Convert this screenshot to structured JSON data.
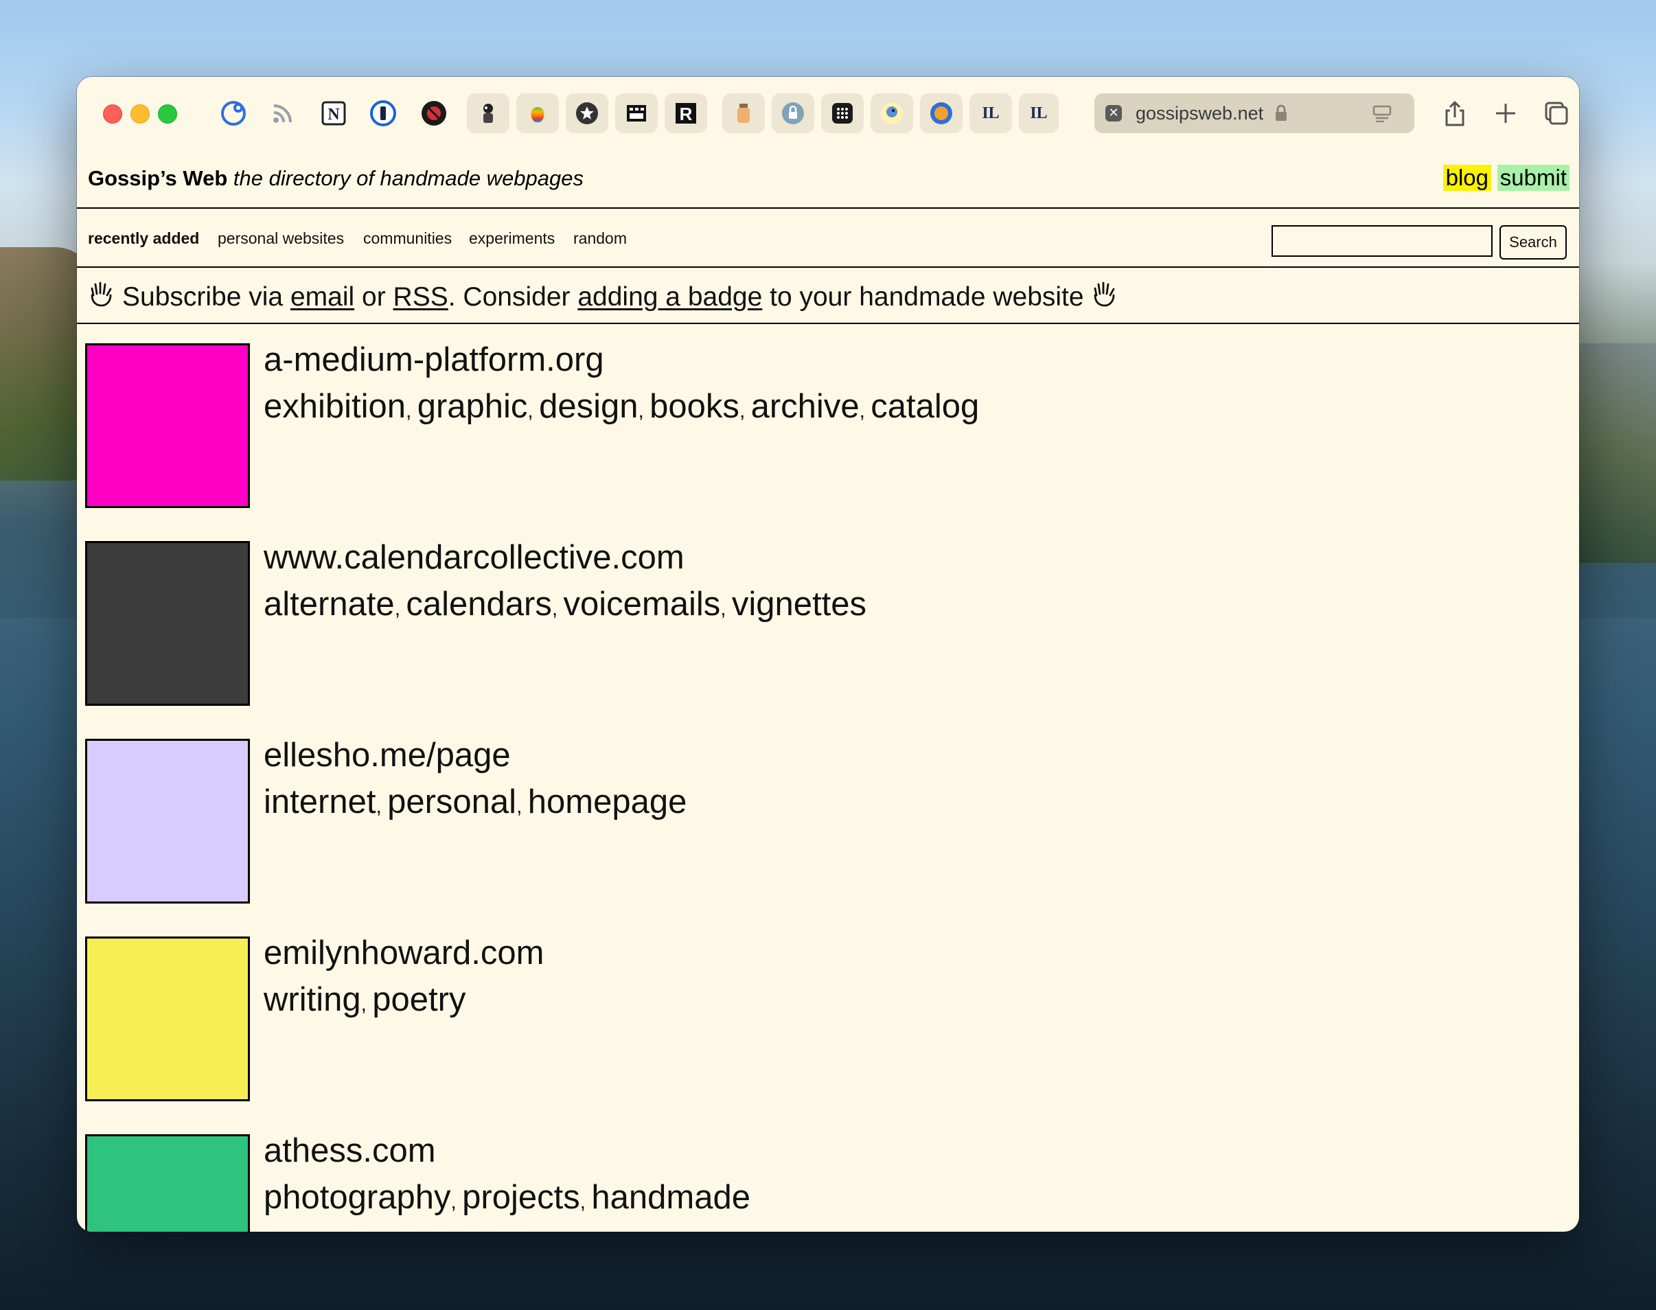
{
  "browser": {
    "url": "gossipsweb.net"
  },
  "header": {
    "site_name": "Gossip’s Web",
    "tagline": "the directory of handmade webpages",
    "blog_label": "blog",
    "submit_label": "submit",
    "blog_color": "#fcf100",
    "submit_color": "#a8f2a8"
  },
  "nav": {
    "items": [
      {
        "label": "recently added"
      },
      {
        "label": "personal websites"
      },
      {
        "label": "communities"
      },
      {
        "label": "experiments"
      },
      {
        "label": "random"
      }
    ],
    "search_value": "",
    "search_button": "Search"
  },
  "subscribe": {
    "prefix": "Subscribe via",
    "email_link": "email",
    "or": "or",
    "rss_link": "RSS",
    "consider": ". Consider",
    "badge_link": "adding a badge",
    "suffix": "to your handmade website"
  },
  "entries": [
    {
      "url": "a-medium-platform.org",
      "tags": [
        "exhibition",
        "graphic",
        "design",
        "books",
        "archive",
        "catalog"
      ],
      "color": "#ff00c4"
    },
    {
      "url": "www.calendarcollective.com",
      "tags": [
        "alternate",
        "calendars",
        "voicemails",
        "vignettes"
      ],
      "color": "#3c3c3c"
    },
    {
      "url": "ellesho.me/page",
      "tags": [
        "internet",
        "personal",
        "homepage"
      ],
      "color": "#d8ccff"
    },
    {
      "url": "emilynhoward.com",
      "tags": [
        "writing",
        "poetry"
      ],
      "color": "#f7ee55"
    },
    {
      "url": "athess.com",
      "tags": [
        "photography",
        "projects",
        "handmade"
      ],
      "color": "#2ec47d"
    }
  ]
}
